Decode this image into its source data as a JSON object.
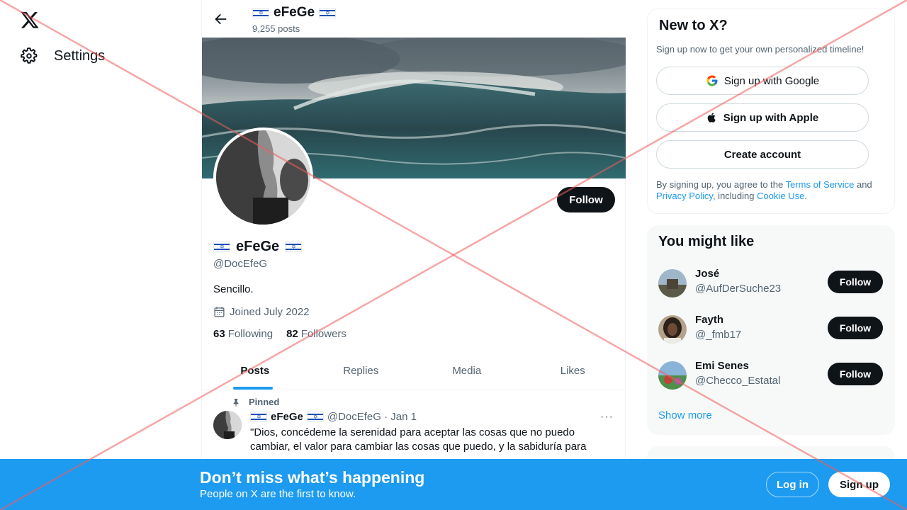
{
  "nav": {
    "logo_icon": "x-logo-icon",
    "settings_label": "Settings"
  },
  "header": {
    "name": "eFeGe",
    "post_count": "9,255 posts"
  },
  "profile": {
    "name": "eFeGe",
    "handle": "@DocEfeG",
    "bio": "Sencillo.",
    "joined": "Joined July 2022",
    "following_count": "63",
    "following_label": "Following",
    "followers_count": "82",
    "followers_label": "Followers",
    "follow_label": "Follow"
  },
  "tabs": [
    {
      "label": "Posts",
      "active": true
    },
    {
      "label": "Replies",
      "active": false
    },
    {
      "label": "Media",
      "active": false
    },
    {
      "label": "Likes",
      "active": false
    }
  ],
  "pinned_tweet": {
    "pinned_label": "Pinned",
    "author_name": "eFeGe",
    "handle_date": "@DocEfeG · Jan 1",
    "more": "···",
    "text": "\"Dios, concédeme la serenidad para aceptar las cosas que no puedo cambiar, el valor para cambiar las cosas que puedo, y la sabiduría para"
  },
  "signup_card": {
    "title": "New to X?",
    "subtitle": "Sign up now to get your own personalized timeline!",
    "google_label": "Sign up with Google",
    "apple_label": "Sign up with Apple",
    "create_label": "Create account",
    "terms_prefix": "By signing up, you agree to the ",
    "terms_link": "Terms of Service",
    "terms_mid": " and ",
    "privacy_link": "Privacy Policy",
    "terms_mid2": ", including ",
    "cookie_link": "Cookie Use",
    "terms_end": "."
  },
  "suggestions": {
    "title": "You might like",
    "users": [
      {
        "name": "José",
        "handle": "@AufDerSuche23",
        "follow": "Follow"
      },
      {
        "name": "Fayth",
        "handle": "@_fmb17",
        "follow": "Follow"
      },
      {
        "name": "Emi Senes",
        "handle": "@Checco_Estatal",
        "follow": "Follow"
      }
    ],
    "show_more": "Show more"
  },
  "bottom_bar": {
    "title": "Don’t miss what’s happening",
    "subtitle": "People on X are the first to know.",
    "login": "Log in",
    "signup": "Sign up"
  },
  "colors": {
    "accent": "#1d9bf0",
    "dark": "#0f1419",
    "muted": "#536471"
  }
}
